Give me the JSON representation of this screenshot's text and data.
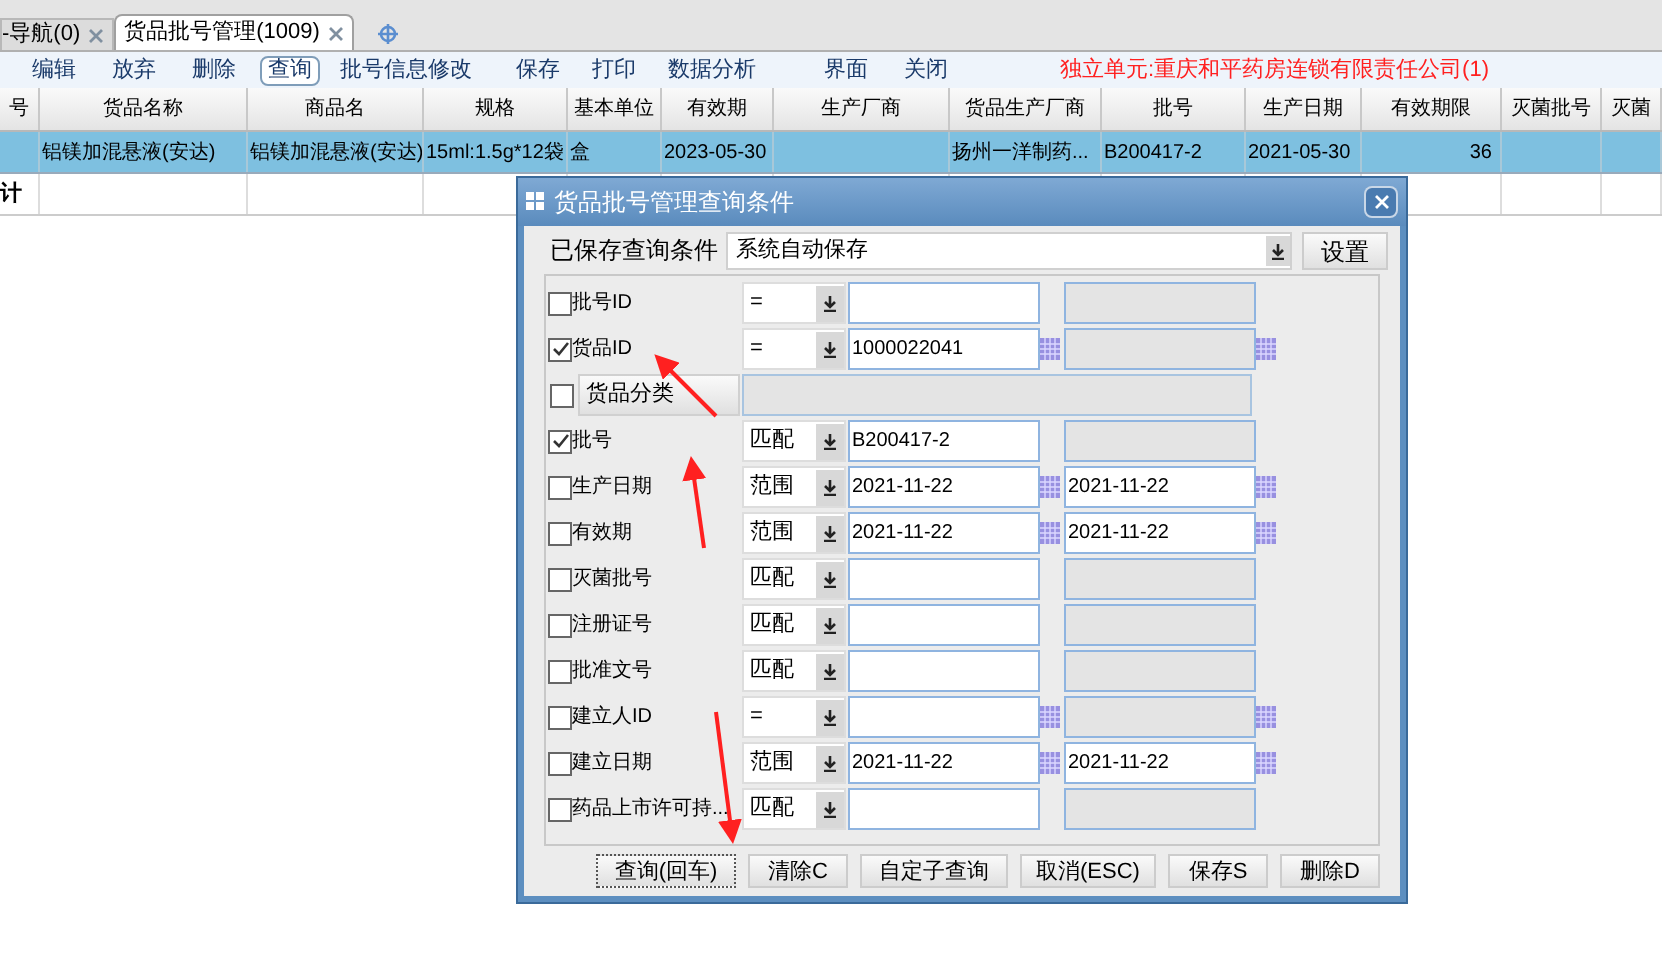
{
  "tabs": [
    {
      "label": "-导航(0)",
      "selected": false
    },
    {
      "label": "货品批号管理(1009)",
      "selected": true
    }
  ],
  "toolbar": [
    {
      "label": "编辑",
      "selected": false
    },
    {
      "label": "放弃",
      "selected": false
    },
    {
      "label": "删除",
      "selected": false
    },
    {
      "label": "查询",
      "selected": true
    },
    {
      "label": "批号信息修改",
      "selected": false
    },
    {
      "label": "保存",
      "selected": false
    },
    {
      "label": "打印",
      "selected": false
    },
    {
      "label": "数据分析",
      "selected": false
    },
    {
      "label": "界面",
      "selected": false
    },
    {
      "label": "关闭",
      "selected": false
    }
  ],
  "unit_notice": "独立单元:重庆和平药房连锁有限责任公司(1)",
  "table": {
    "columns": [
      "号",
      "货品名称",
      "商品名",
      "规格",
      "基本单位",
      "有效期",
      "生产厂商",
      "货品生产厂商",
      "批号",
      "生产日期",
      "有效期限",
      "灭菌批号",
      "灭菌"
    ],
    "rows": [
      [
        "",
        "铝镁加混悬液(安达)",
        "铝镁加混悬液(安达)",
        "15ml:1.5g*12袋",
        "盒",
        "2023-05-30",
        "",
        "扬州一洋制药...",
        "B200417-2",
        "2021-05-30",
        "36",
        "",
        ""
      ]
    ],
    "footer": "计"
  },
  "dialog": {
    "title": "货品批号管理查询条件",
    "saved_label": "已保存查询条件",
    "saved_value": "系统自动保存",
    "settings_button": "设置",
    "conditions": [
      {
        "kind": "field",
        "label": "批号ID",
        "checked": false,
        "operator": "=",
        "picker": false
      },
      {
        "kind": "field",
        "label": "货品ID",
        "checked": true,
        "operator": "=",
        "value": "1000022041",
        "picker": true
      },
      {
        "kind": "category",
        "label": "货品分类",
        "checked": false
      },
      {
        "kind": "field",
        "label": "批号",
        "checked": true,
        "operator": "匹配",
        "value": "B200417-2",
        "picker": false
      },
      {
        "kind": "range",
        "label": "生产日期",
        "checked": false,
        "operator": "范围",
        "value": "2021-11-22",
        "value_to": "2021-11-22",
        "picker": true
      },
      {
        "kind": "range",
        "label": "有效期",
        "checked": false,
        "operator": "范围",
        "value": "2021-11-22",
        "value_to": "2021-11-22",
        "picker": true
      },
      {
        "kind": "field",
        "label": "灭菌批号",
        "checked": false,
        "operator": "匹配",
        "picker": false
      },
      {
        "kind": "field",
        "label": "注册证号",
        "checked": false,
        "operator": "匹配",
        "picker": false
      },
      {
        "kind": "field",
        "label": "批准文号",
        "checked": false,
        "operator": "匹配",
        "picker": false
      },
      {
        "kind": "field",
        "label": "建立人ID",
        "checked": false,
        "operator": "=",
        "picker": true
      },
      {
        "kind": "range",
        "label": "建立日期",
        "checked": false,
        "operator": "范围",
        "value": "2021-11-22",
        "value_to": "2021-11-22",
        "picker": true
      },
      {
        "kind": "field",
        "label": "药品上市许可持...",
        "checked": false,
        "operator": "匹配",
        "picker": false
      }
    ],
    "buttons": [
      {
        "label": "查询(回车)",
        "selected": true
      },
      {
        "label": "清除C",
        "selected": false
      },
      {
        "label": "自定子查询",
        "selected": false
      },
      {
        "label": "取消(ESC)",
        "selected": false
      },
      {
        "label": "保存S",
        "selected": false
      },
      {
        "label": "删除D",
        "selected": false
      }
    ]
  }
}
